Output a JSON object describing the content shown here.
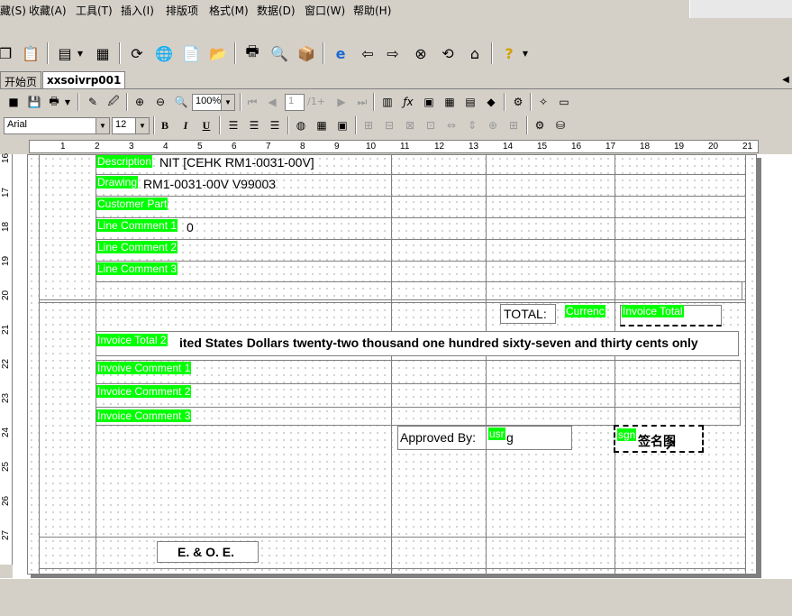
{
  "menu": {
    "items": [
      "藏(S)",
      "收藏(A)",
      "工具(T)",
      "插入(I)",
      "排版项",
      "格式(M)",
      "数据(D)",
      "窗口(W)",
      "帮助(H)"
    ]
  },
  "tabs": [
    {
      "label": "开始页",
      "active": false
    },
    {
      "label": "xxsoivrp001",
      "active": true
    }
  ],
  "toolbar": {
    "zoom": "100%",
    "page_input": "1",
    "page_total": "/1+",
    "font_name": "Arial",
    "font_size": "12",
    "bold": "B",
    "italic": "I",
    "underline": "U"
  },
  "ruler": {
    "h_numbers": [
      "1",
      "2",
      "3",
      "4",
      "5",
      "6",
      "7",
      "8",
      "9",
      "10",
      "11",
      "12",
      "13",
      "14",
      "15",
      "16",
      "17",
      "18",
      "19",
      "20",
      "21"
    ],
    "v_numbers": [
      "16",
      "17",
      "18",
      "19",
      "20",
      "21",
      "22",
      "23",
      "24",
      "25",
      "26",
      "27"
    ]
  },
  "report": {
    "description_field": "Description",
    "description_value": "NIT  [CEHK RM1-0031-00V]",
    "drawing_field": "Drawing",
    "drawing_value": "RM1-0031-00V V99003",
    "customer_part_field": "Customer Part",
    "line_comment1_field": "Line Comment 1",
    "line_comment1_value": "0",
    "line_comment2_field": "Line Comment 2",
    "line_comment3_field": "Line Comment 3",
    "total_label": "TOTAL:",
    "currency_field": "Currenc",
    "invoice_total_field": "Invoice Total",
    "invoice_total2_field": "Invoice Total 2",
    "amount_words": "ited States Dollars twenty-two thousand one hundred sixty-seven and thirty cents only",
    "invoice_comment1_field": "Invoive Comment 1",
    "invoice_comment2_field": "Invoice Comment 2",
    "invoice_comment3_field": "Invoice Comment 3",
    "approved_by_label": "Approved By:",
    "user_field": "usr",
    "user_suffix": "g",
    "sign_field": "sgn",
    "sign_image_label": "签名图",
    "eoe_label": "E. & O. E."
  },
  "colors": {
    "field_bg": "#00ff00",
    "chrome": "#d4d0c8"
  }
}
